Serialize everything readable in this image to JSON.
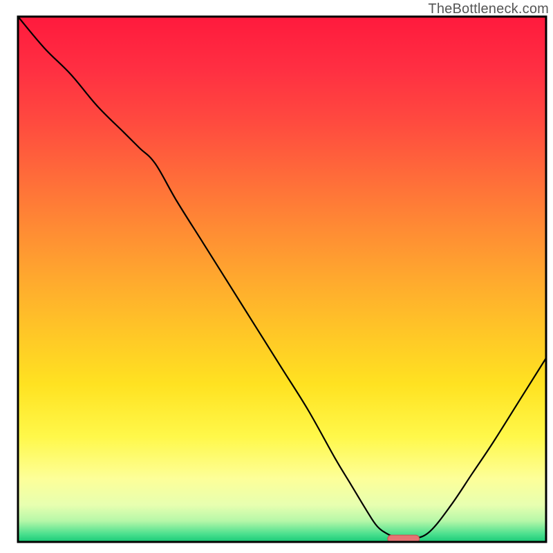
{
  "watermark": "TheBottleneck.com",
  "chart_data": {
    "type": "line",
    "title": "",
    "xlabel": "",
    "ylabel": "",
    "xlim": [
      0,
      100
    ],
    "ylim": [
      0,
      100
    ],
    "background": {
      "type": "vertical-gradient",
      "stops": [
        {
          "offset": 0.0,
          "color": "#ff1a3d"
        },
        {
          "offset": 0.1,
          "color": "#ff2f42"
        },
        {
          "offset": 0.2,
          "color": "#ff4a3f"
        },
        {
          "offset": 0.3,
          "color": "#ff6a3a"
        },
        {
          "offset": 0.4,
          "color": "#ff8a34"
        },
        {
          "offset": 0.5,
          "color": "#ffa92e"
        },
        {
          "offset": 0.6,
          "color": "#ffc627"
        },
        {
          "offset": 0.7,
          "color": "#ffe221"
        },
        {
          "offset": 0.8,
          "color": "#fff84a"
        },
        {
          "offset": 0.88,
          "color": "#fdff99"
        },
        {
          "offset": 0.93,
          "color": "#e7ffb0"
        },
        {
          "offset": 0.96,
          "color": "#b6f7a8"
        },
        {
          "offset": 0.985,
          "color": "#4be08e"
        },
        {
          "offset": 1.0,
          "color": "#18c977"
        }
      ]
    },
    "series": [
      {
        "name": "bottleneck-curve",
        "color": "#000000",
        "stroke_width": 2.2,
        "x": [
          0,
          5,
          10,
          15,
          20,
          23,
          26,
          30,
          35,
          40,
          45,
          50,
          55,
          60,
          63,
          66,
          68,
          70,
          72,
          73,
          75,
          78,
          82,
          86,
          90,
          95,
          100
        ],
        "y": [
          100,
          94,
          89,
          83,
          78,
          75,
          72,
          65,
          57,
          49,
          41,
          33,
          25,
          16,
          11,
          6,
          3,
          1.5,
          0.7,
          0.5,
          0.6,
          2,
          7,
          13,
          19,
          27,
          35
        ]
      }
    ],
    "marker": {
      "name": "optimal-range",
      "shape": "rounded-bar",
      "x_center": 73,
      "y_center": 0.6,
      "width": 6,
      "height": 1.4,
      "fill": "#e57373",
      "stroke": "#c84f4f"
    },
    "axes": {
      "frame_color": "#000000",
      "frame_width": 3,
      "grid": false,
      "ticks": []
    }
  }
}
